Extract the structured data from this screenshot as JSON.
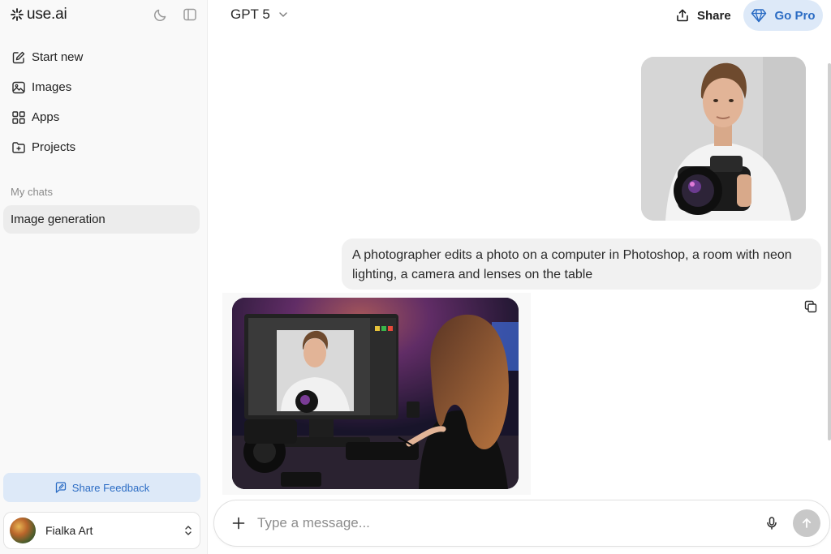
{
  "app": {
    "logo_text": "use.ai"
  },
  "sidebar": {
    "items": [
      {
        "label": "Start new",
        "icon": "edit-icon"
      },
      {
        "label": "Images",
        "icon": "image-icon"
      },
      {
        "label": "Apps",
        "icon": "grid-icon"
      },
      {
        "label": "Projects",
        "icon": "folder-plus-icon"
      }
    ],
    "section_label": "My chats",
    "chats": [
      {
        "label": "Image generation",
        "active": true
      }
    ],
    "feedback_label": "Share Feedback",
    "user": {
      "name": "Fialka Art"
    }
  },
  "header": {
    "model": "GPT 5",
    "share_label": "Share",
    "gopro_label": "Go Pro"
  },
  "chat": {
    "messages": [
      {
        "role": "user",
        "type": "image",
        "alt": "uploaded-portrait"
      },
      {
        "role": "user",
        "type": "text",
        "text": "A photographer edits a photo on a computer in Photoshop, a room with neon lighting, a camera and lenses on the table"
      },
      {
        "role": "assistant",
        "type": "image",
        "alt": "generated-image"
      }
    ]
  },
  "composer": {
    "placeholder": "Type a message..."
  },
  "colors": {
    "accent": "#2b6cc4",
    "accent_bg": "#dde9f8",
    "sidebar_bg": "#f9f9f9",
    "bubble_bg": "#f1f1f1"
  }
}
